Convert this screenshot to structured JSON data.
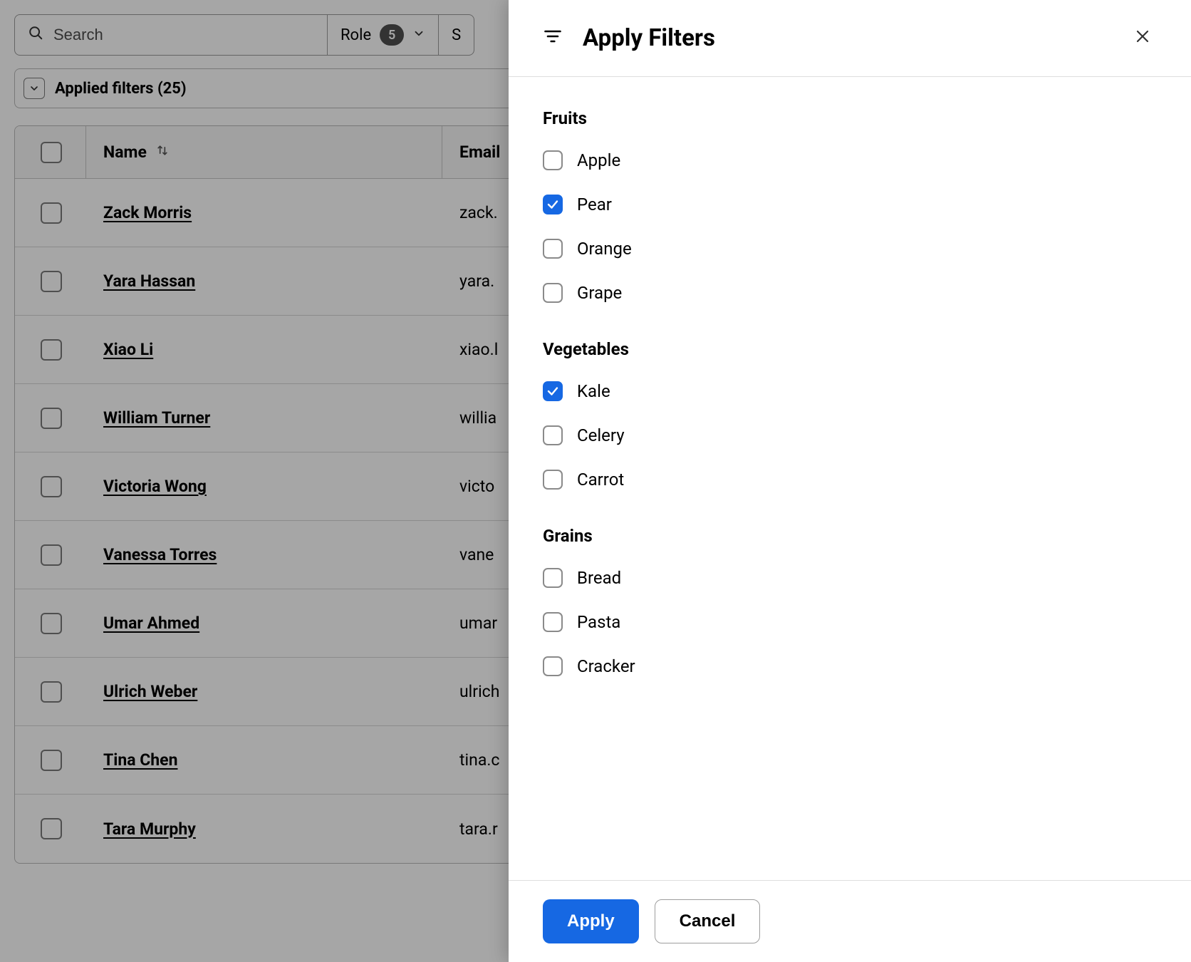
{
  "toolbar": {
    "search_placeholder": "Search",
    "role_label": "Role",
    "role_count": "5",
    "status_label": "S"
  },
  "applied_filters_label": "Applied filters (25)",
  "table": {
    "columns": {
      "name": "Name",
      "email": "Email"
    },
    "rows": [
      {
        "name": "Zack Morris",
        "email": "zack."
      },
      {
        "name": "Yara Hassan",
        "email": "yara."
      },
      {
        "name": "Xiao Li",
        "email": "xiao.l"
      },
      {
        "name": "William Turner",
        "email": "willia"
      },
      {
        "name": "Victoria Wong",
        "email": "victo"
      },
      {
        "name": "Vanessa Torres",
        "email": "vane"
      },
      {
        "name": "Umar Ahmed",
        "email": "umar"
      },
      {
        "name": "Ulrich Weber",
        "email": "ulrich"
      },
      {
        "name": "Tina Chen",
        "email": "tina.c"
      },
      {
        "name": "Tara Murphy",
        "email": "tara.r"
      }
    ]
  },
  "drawer": {
    "title": "Apply Filters",
    "apply_label": "Apply",
    "cancel_label": "Cancel",
    "groups": [
      {
        "title": "Fruits",
        "options": [
          {
            "label": "Apple",
            "checked": false
          },
          {
            "label": "Pear",
            "checked": true
          },
          {
            "label": "Orange",
            "checked": false
          },
          {
            "label": "Grape",
            "checked": false
          }
        ]
      },
      {
        "title": "Vegetables",
        "options": [
          {
            "label": "Kale",
            "checked": true
          },
          {
            "label": "Celery",
            "checked": false
          },
          {
            "label": "Carrot",
            "checked": false
          }
        ]
      },
      {
        "title": "Grains",
        "options": [
          {
            "label": "Bread",
            "checked": false
          },
          {
            "label": "Pasta",
            "checked": false
          },
          {
            "label": "Cracker",
            "checked": false
          }
        ]
      }
    ]
  }
}
